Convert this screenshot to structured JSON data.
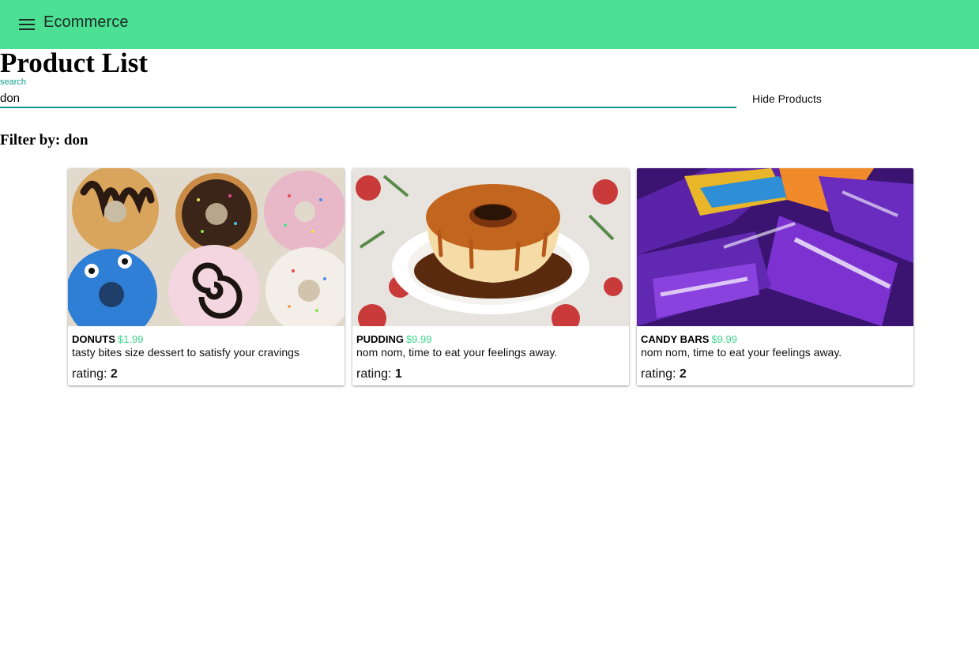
{
  "toolbar": {
    "menu_icon": "hamburger-menu-icon",
    "title": "Ecommerce",
    "bg_color": "#4be093"
  },
  "page": {
    "title": "Product List"
  },
  "search": {
    "label": "search",
    "value": "don",
    "hide_button": "Hide Products"
  },
  "filter": {
    "label": "Filter by: don"
  },
  "products": [
    {
      "name": "DONUTS",
      "price": "$1.99",
      "description": "tasty bites size dessert to satisfy your cravings",
      "rating_label": "rating:",
      "rating": "2",
      "image": "donuts-photo"
    },
    {
      "name": "PUDDING",
      "price": "$9.99",
      "description": "nom nom, time to eat your feelings away.",
      "rating_label": "rating:",
      "rating": "1",
      "image": "pudding-photo"
    },
    {
      "name": "CANDY BARS",
      "price": "$9.99",
      "description": "nom nom, time to eat your feelings away.",
      "rating_label": "rating:",
      "rating": "2",
      "image": "candy-bars-photo"
    }
  ],
  "colors": {
    "accent": "#4be093",
    "price": "#3dd68a",
    "input_underline": "#14958a"
  }
}
